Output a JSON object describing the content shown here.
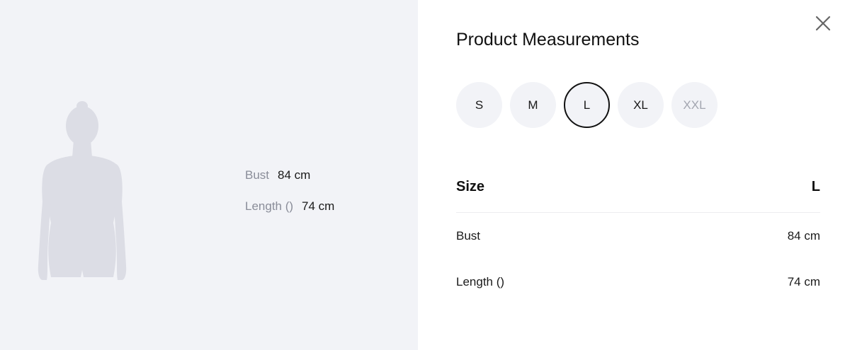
{
  "title": "Product Measurements",
  "close_icon": "close-icon",
  "figure": {
    "icon": "female-silhouette-icon",
    "measurements": [
      {
        "label": "Bust",
        "value": "84 cm"
      },
      {
        "label": "Length ()",
        "value": "74 cm"
      }
    ]
  },
  "sizes": [
    {
      "label": "S",
      "state": "normal"
    },
    {
      "label": "M",
      "state": "normal"
    },
    {
      "label": "L",
      "state": "selected"
    },
    {
      "label": "XL",
      "state": "normal"
    },
    {
      "label": "XXL",
      "state": "disabled"
    }
  ],
  "table": {
    "header_label": "Size",
    "header_value": "L",
    "rows": [
      {
        "label": "Bust",
        "value": "84 cm"
      },
      {
        "label": "Length ()",
        "value": "74 cm"
      }
    ]
  },
  "colors": {
    "panel_bg": "#f2f3f7",
    "silhouette": "#dcdde5",
    "selected_border": "#111111",
    "disabled_text": "#a3a6b0"
  }
}
